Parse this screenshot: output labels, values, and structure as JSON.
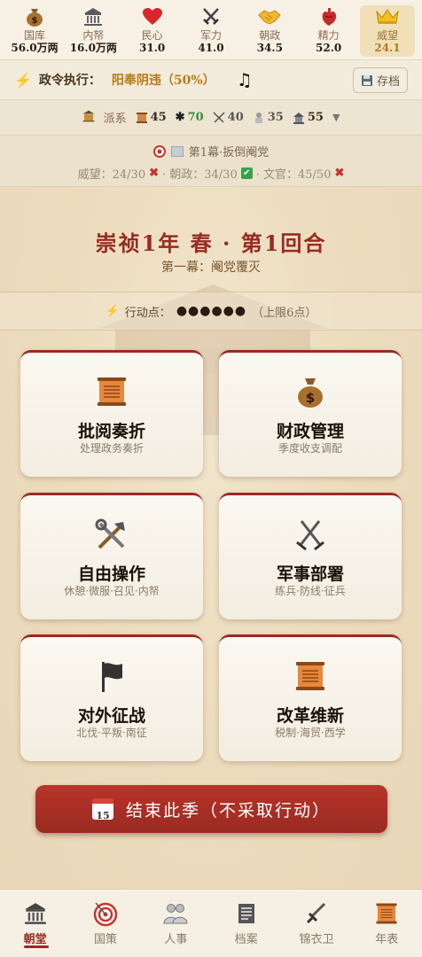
{
  "stats": [
    {
      "label": "国库",
      "value": "56.0万两",
      "icon": "money-bag-icon"
    },
    {
      "label": "内帑",
      "value": "16.0万两",
      "icon": "palace-icon"
    },
    {
      "label": "民心",
      "value": "31.0",
      "icon": "heart-icon"
    },
    {
      "label": "军力",
      "value": "41.0",
      "icon": "crossed-swords-icon"
    },
    {
      "label": "朝政",
      "value": "34.5",
      "icon": "handshake-icon"
    },
    {
      "label": "精力",
      "value": "52.0",
      "icon": "anatomical-heart-icon"
    },
    {
      "label": "威望",
      "value": "24.1",
      "icon": "crown-icon"
    }
  ],
  "policy": {
    "label": "政令执行：",
    "value": "阳奉阴违（50%）",
    "save_label": "存档"
  },
  "factions": {
    "label": "派系",
    "items": [
      {
        "value": "45",
        "icon": "scroll-icon"
      },
      {
        "value": "70",
        "icon": "spider-icon"
      },
      {
        "value": "40",
        "icon": "swords-icon"
      },
      {
        "value": "35",
        "icon": "merchant-icon"
      },
      {
        "value": "55",
        "icon": "temple-icon"
      }
    ]
  },
  "goal": {
    "act_title": "第1幕·扳倒阉党",
    "req1": "威望：24/30",
    "req2": "· 朝政：34/30",
    "req3": "· 文官：45/50"
  },
  "main": {
    "title": "崇祯1年 春 · 第1回合",
    "subtitle": "第一幕：阉党覆灭",
    "ap_label": "行动点：",
    "ap_dots": "●●●●●●",
    "ap_limit": "（上限6点）"
  },
  "cards": [
    {
      "title": "批阅奏折",
      "sub": "处理政务奏折",
      "icon": "scroll-icon"
    },
    {
      "title": "财政管理",
      "sub": "季度收支调配",
      "icon": "money-bag-icon"
    },
    {
      "title": "自由操作",
      "sub": "休憩·微服·召见·内帑",
      "icon": "tools-icon"
    },
    {
      "title": "军事部署",
      "sub": "练兵·防线·征兵",
      "icon": "crossed-swords-icon"
    },
    {
      "title": "对外征战",
      "sub": "北伐·平叛·南征",
      "icon": "flag-icon"
    },
    {
      "title": "改革维新",
      "sub": "税制·海贸·西学",
      "icon": "scroll-icon"
    }
  ],
  "end_button": {
    "label": "结束此季（不采取行动）",
    "calendar_day": "15"
  },
  "nav": [
    {
      "label": "朝堂",
      "icon": "palace-icon",
      "active": true
    },
    {
      "label": "国策",
      "icon": "target-icon"
    },
    {
      "label": "人事",
      "icon": "people-icon"
    },
    {
      "label": "档案",
      "icon": "document-icon"
    },
    {
      "label": "锦衣卫",
      "icon": "dagger-icon"
    },
    {
      "label": "年表",
      "icon": "scroll-icon"
    }
  ],
  "colors": {
    "accent": "#9a2a22",
    "gold": "#b07a20",
    "background": "#efe6d4"
  }
}
